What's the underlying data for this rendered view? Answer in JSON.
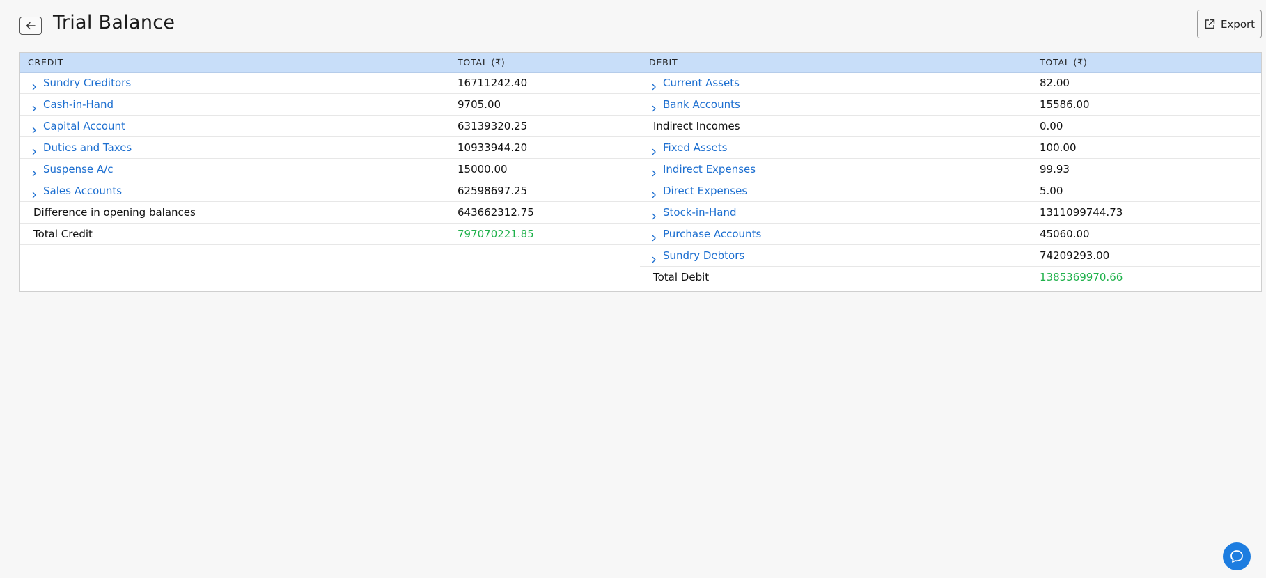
{
  "page": {
    "title": "Trial Balance"
  },
  "toolbar": {
    "export_label": "Export"
  },
  "table": {
    "credit_header": "CREDIT",
    "credit_total_header": "TOTAL (₹)",
    "debit_header": "DEBIT",
    "debit_total_header": "TOTAL (₹)",
    "credit_rows": [
      {
        "label": "Sundry Creditors",
        "amount": "16711242.40",
        "expandable": true
      },
      {
        "label": "Cash-in-Hand",
        "amount": "9705.00",
        "expandable": true
      },
      {
        "label": "Capital Account",
        "amount": "63139320.25",
        "expandable": true
      },
      {
        "label": "Duties and Taxes",
        "amount": "10933944.20",
        "expandable": true
      },
      {
        "label": "Suspense A/c",
        "amount": "15000.00",
        "expandable": true
      },
      {
        "label": "Sales Accounts",
        "amount": "62598697.25",
        "expandable": true
      },
      {
        "label": "Difference in opening balances",
        "amount": "643662312.75",
        "expandable": false
      }
    ],
    "credit_total": {
      "label": "Total Credit",
      "amount": "797070221.85"
    },
    "debit_rows": [
      {
        "label": "Current Assets",
        "amount": "82.00",
        "expandable": true
      },
      {
        "label": "Bank Accounts",
        "amount": "15586.00",
        "expandable": true
      },
      {
        "label": "Indirect Incomes",
        "amount": "0.00",
        "expandable": false
      },
      {
        "label": "Fixed Assets",
        "amount": "100.00",
        "expandable": true
      },
      {
        "label": "Indirect Expenses",
        "amount": "99.93",
        "expandable": true
      },
      {
        "label": "Direct Expenses",
        "amount": "5.00",
        "expandable": true
      },
      {
        "label": "Stock-in-Hand",
        "amount": "1311099744.73",
        "expandable": true
      },
      {
        "label": "Purchase Accounts",
        "amount": "45060.00",
        "expandable": true
      },
      {
        "label": "Sundry Debtors",
        "amount": "74209293.00",
        "expandable": true
      }
    ],
    "debit_total": {
      "label": "Total Debit",
      "amount": "1385369970.66"
    }
  },
  "colors": {
    "link": "#1d6fd0",
    "total": "#1fb14b",
    "header_bg": "#c8def9",
    "chat": "#1d7de0"
  },
  "icons": {
    "back": "arrow-left-icon",
    "export": "export-icon",
    "expand": "chevron-right-icon",
    "chat": "chat-bubble-icon"
  }
}
